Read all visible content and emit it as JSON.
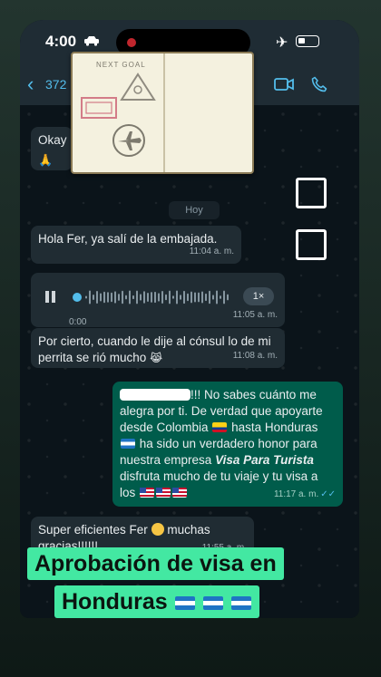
{
  "status_bar": {
    "time": "4:00"
  },
  "header": {
    "contact_number": "372"
  },
  "passport": {
    "stamp_label": "NEXT GOAL"
  },
  "date_divider": "Hoy",
  "messages": {
    "m1": {
      "text": "Okay"
    },
    "m2": {
      "text": "Hola Fer, ya salí de la embajada.",
      "time": "11:04 a. m."
    },
    "m3": {
      "elapsed": "0:00",
      "speed": "1×",
      "time": "11:05 a. m."
    },
    "m4": {
      "text": "Por cierto, cuando le dije al cónsul lo de mi perrita se rió mucho",
      "time": "11:08 a. m."
    },
    "m5": {
      "greeting_tail": "!!! No sabes cuánto me alegra por ti. De verdad que apoyarte desde Colombia",
      "mid": "hasta Honduras",
      "honor": "ha sido un verdadero honor para nuestra empresa",
      "brand": "Visa Para Turista",
      "end": "disfruta mucho de tu viaje y tu visa a los",
      "time": "11:17 a. m."
    },
    "m6": {
      "text": "Super eficientes Fer",
      "text2": "muchas gracias!!!!!!",
      "time": "11:55 a. m."
    }
  },
  "banner": {
    "line1": "Aprobación de visa en",
    "line2": "Honduras"
  },
  "colors": {
    "accent_link": "#53bdeb",
    "outgoing_bubble": "#005c4b",
    "incoming_bubble": "#202c33",
    "banner": "#43e8a2"
  }
}
